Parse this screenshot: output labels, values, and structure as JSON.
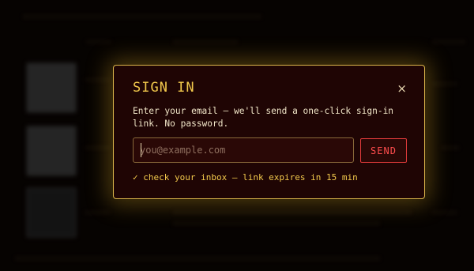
{
  "dialog": {
    "title": "SIGN IN",
    "close_label": "×",
    "description": "Enter your email — we'll send a one-click sign-in link. No password.",
    "email_placeholder": "you@example.com",
    "email_value": "",
    "send_label": "SEND",
    "status": "✓ check your inbox — link expires in 15 min"
  },
  "colors": {
    "accent": "#f2c94c",
    "danger": "#ff4d4d",
    "dialog_bg": "#1f0504",
    "border": "#d9b44a"
  }
}
